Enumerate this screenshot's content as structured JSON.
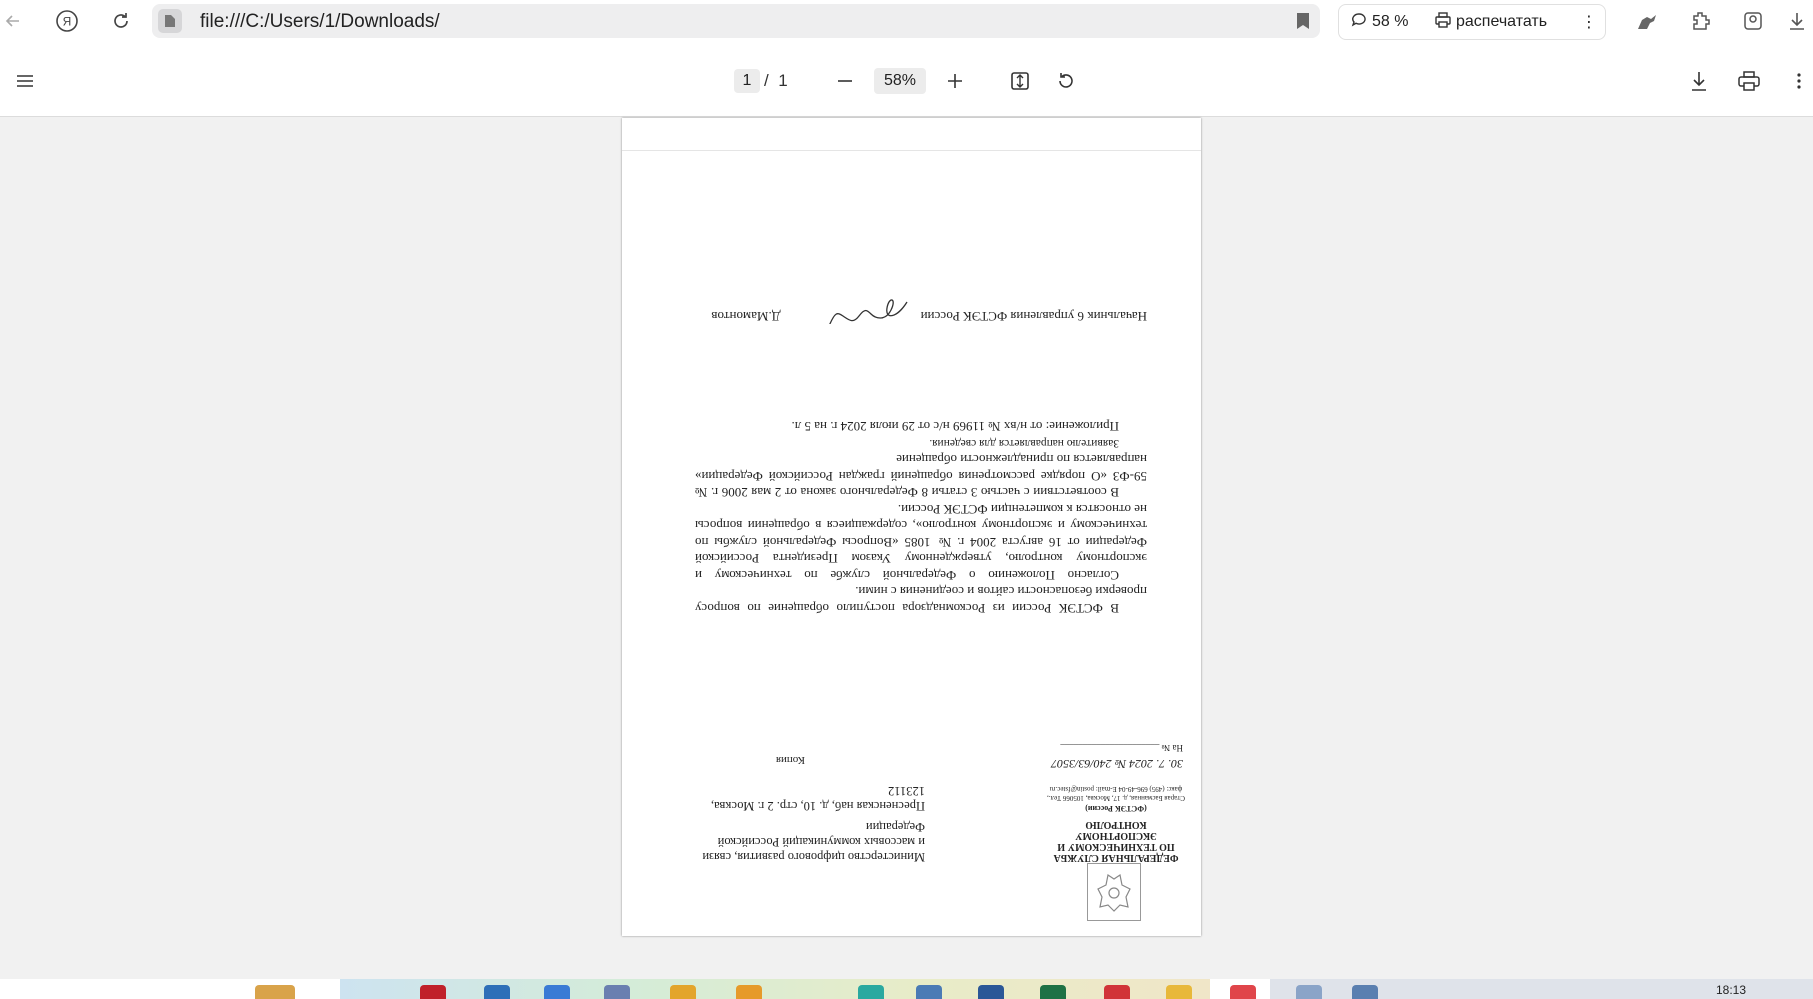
{
  "browser": {
    "url": "file:///C:/Users/1/Downloads/",
    "zoom_pill": "58 %",
    "print_pill": "распечатать",
    "more_pill": "⋮"
  },
  "pdf_toolbar": {
    "current_page": "1",
    "page_sep": "/",
    "total_pages": "1",
    "zoom": "58%"
  },
  "document": {
    "agency_name": "ФЕДЕРАЛЬНАЯ СЛУЖБА ПО ТЕХНИЧЕСКОМУ И ЭКСПОРТНОМУ КОНТРОЛЮ",
    "agency_short": "(ФСТЭК России)",
    "agency_address": "Старая Басманная, д. 17, Москва, 105066 Тел., факс: (495) 696-49-04 E-mail: postin@fstec.ru",
    "outgoing_number": "30. 7. 2024 № 240/63/3507",
    "in_reference": "На № ______________________",
    "recipient": "Министерство цифрового развития, связи и массовых коммуникаций Российской Федерации",
    "recipient_address": "Пресненская наб, д. 10, стр. 2 г. Москва, 123112",
    "copy_mark": "Копия",
    "paragraph1": "В ФСТЭК России из Роскомнадзора поступило обращение по вопросу проверки безопасности сайтов и соединения с ними.",
    "paragraph2": "Согласно Положению о Федеральной службе по техническому и экспортному контролю, утвержденному Указом Президента Российской Федерации от 16 августа 2004 г. № 1085 «Вопросы Федеральной службы по техническому и экспортному контролю», содержащиеся в обращении вопросы не относятся к компетенции ФСТЭК России.",
    "paragraph3": "В соответствии с частью 3 статьи 8 Федерального закона от 2 мая 2006 г. № 59-ФЗ «О порядке рассмотрения обращений граждан Российской Федерации» направляется по принадлежности обращение",
    "paragraph4": "Заявителю направляется для сведения.",
    "attachment": "Приложение: от н/вх № 11969 н/с от 29 июля 2024 г. на 5 л.",
    "signer_title": "Начальник 6 управления ФСТЭК России",
    "signer_name": "Д.Мамонтов"
  },
  "taskbar": {
    "clock": "18:13"
  }
}
